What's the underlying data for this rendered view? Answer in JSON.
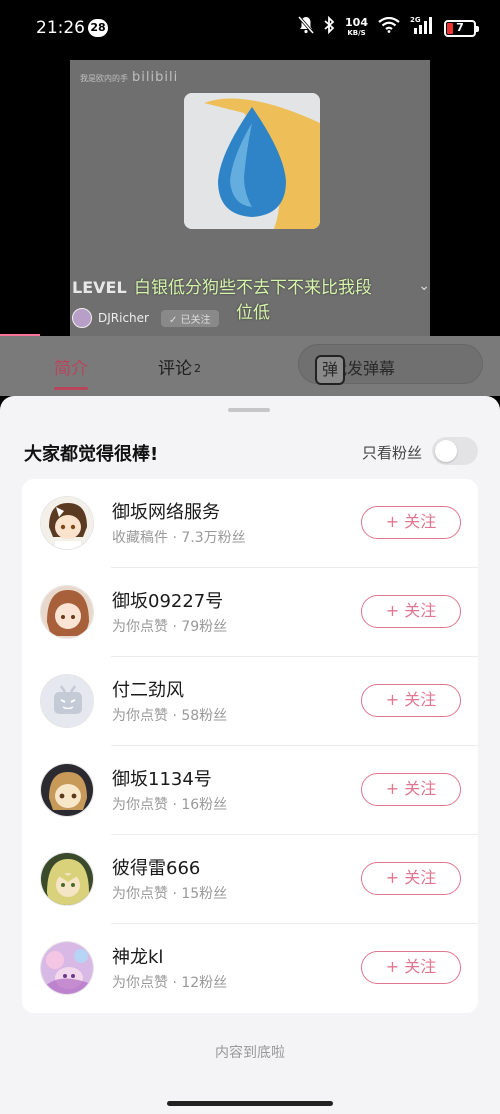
{
  "status_bar": {
    "time": "21:26",
    "badge": "28",
    "speed_value": "104",
    "speed_unit": "KB/S",
    "network": "2G",
    "battery": "7"
  },
  "video": {
    "watermark_text": "我是欧内的手",
    "watermark_logo": "bilibili",
    "title_prefix": "LEVEL",
    "danmaku": "白银低分狗些不去下不来比我段位低",
    "uploader_name": "DJRicher",
    "uploader_follow": "✓ 已关注"
  },
  "tabs": {
    "intro": "简介",
    "comments": "评论",
    "comments_count": "2",
    "danmaku_placeholder": "点我发弹幕",
    "danmaku_btn": "弹"
  },
  "sheet": {
    "title": "大家都觉得很棒!",
    "fans_only_label": "只看粉丝",
    "fans_only_on": false,
    "follow_label": "+ 关注",
    "users": [
      {
        "name": "御坂网络服务",
        "sub": "收藏稿件 · 7.3万粉丝",
        "avatar": "anime-avatar"
      },
      {
        "name": "御坂09227号",
        "sub": "为你点赞 · 79粉丝",
        "avatar": "anime-avatar"
      },
      {
        "name": "付二劲风",
        "sub": "为你点赞 · 58粉丝",
        "avatar": "default-tv-avatar"
      },
      {
        "name": "御坂1134号",
        "sub": "为你点赞 · 16粉丝",
        "avatar": "anime-avatar"
      },
      {
        "name": "彼得雷666",
        "sub": "为你点赞 · 15粉丝",
        "avatar": "anime-avatar"
      },
      {
        "name": "神龙kl",
        "sub": "为你点赞 · 12粉丝",
        "avatar": "anime-avatar"
      }
    ],
    "end_text": "内容到底啦"
  },
  "colors": {
    "accent": "#fb7299",
    "follow": "#e0768f"
  }
}
